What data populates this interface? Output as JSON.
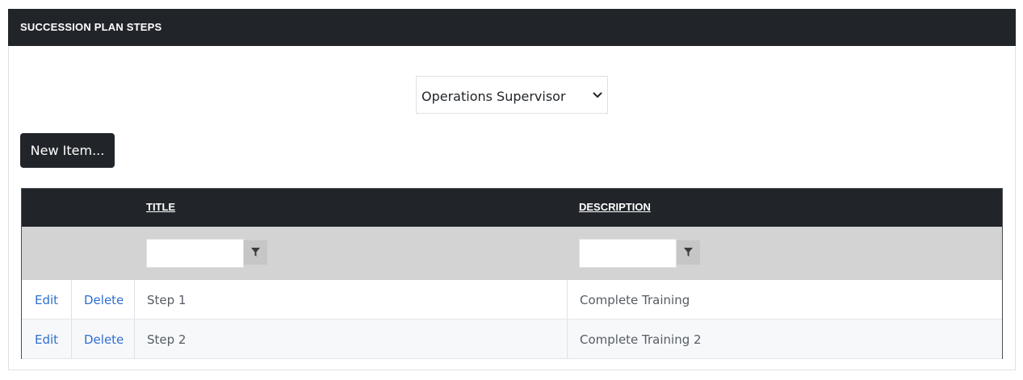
{
  "panel": {
    "title": "SUCCESSION PLAN STEPS"
  },
  "plan_select": {
    "selected": "Operations Supervisor"
  },
  "toolbar": {
    "new_item_label": "New Item..."
  },
  "grid": {
    "columns": {
      "title": "TITLE",
      "description": "DESCRIPTION"
    },
    "rows": [
      {
        "edit": "Edit",
        "delete": "Delete",
        "title": "Step 1",
        "description": "Complete Training"
      },
      {
        "edit": "Edit",
        "delete": "Delete",
        "title": "Step 2",
        "description": "Complete Training 2"
      }
    ]
  },
  "icons": {
    "select_arrow": "chevron-down-icon",
    "filter": "filter-icon"
  },
  "colors": {
    "header_bg": "#212529",
    "filter_row_bg": "#d3d3d3",
    "link": "#2f6fd1"
  }
}
